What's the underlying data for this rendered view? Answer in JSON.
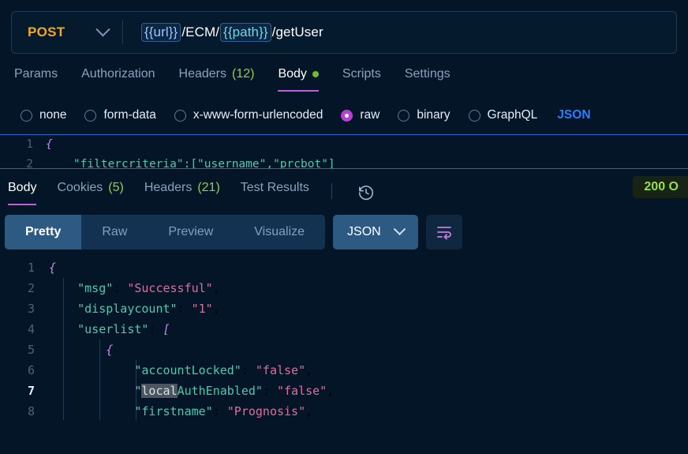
{
  "request": {
    "method": "POST",
    "url_parts": [
      {
        "text": "{{url}}",
        "type": "var-url"
      },
      {
        "text": " /ECM/ ",
        "type": "plain"
      },
      {
        "text": "{{path}}",
        "type": "var-path"
      },
      {
        "text": " /getUser",
        "type": "plain"
      }
    ],
    "url_plain_1": "/ECM/",
    "url_plain_2": "/getUser",
    "var_url": "{{url}}",
    "var_path": "{{path}}",
    "tabs": [
      {
        "label": "Params",
        "active": false
      },
      {
        "label": "Authorization",
        "active": false
      },
      {
        "label": "Headers",
        "count": "(12)",
        "active": false
      },
      {
        "label": "Body",
        "active": true,
        "dot": true
      },
      {
        "label": "Scripts",
        "active": false
      },
      {
        "label": "Settings",
        "active": false
      }
    ],
    "body_types": [
      {
        "label": "none",
        "checked": false
      },
      {
        "label": "form-data",
        "checked": false
      },
      {
        "label": "x-www-form-urlencoded",
        "checked": false
      },
      {
        "label": "raw",
        "checked": true
      },
      {
        "label": "binary",
        "checked": false
      },
      {
        "label": "GraphQL",
        "checked": false
      }
    ],
    "raw_format": "JSON",
    "editor_lines": [
      {
        "num": "1",
        "text": "{"
      },
      {
        "num": "2",
        "text": "    \"filtercriteria\":[\"username\",\"prcbot\"]"
      }
    ]
  },
  "response": {
    "tabs": [
      {
        "label": "Body",
        "active": true
      },
      {
        "label": "Cookies",
        "count": "(5)",
        "active": false
      },
      {
        "label": "Headers",
        "count": "(21)",
        "active": false
      },
      {
        "label": "Test Results",
        "active": false
      }
    ],
    "status": "200 O",
    "history_icon": "clock-history-icon",
    "view_modes": [
      {
        "label": "Pretty",
        "active": true
      },
      {
        "label": "Raw",
        "active": false
      },
      {
        "label": "Preview",
        "active": false
      },
      {
        "label": "Visualize",
        "active": false
      }
    ],
    "format": "JSON",
    "wrap_icon": "word-wrap-icon",
    "body_lines": [
      {
        "num": "1",
        "indent": 0,
        "current": false,
        "segs": [
          {
            "t": "{",
            "c": "p"
          }
        ]
      },
      {
        "num": "2",
        "indent": 1,
        "current": false,
        "segs": [
          {
            "t": "\"msg\"",
            "c": "k"
          },
          {
            "t": ": ",
            "c": ""
          },
          {
            "t": "\"Successful\"",
            "c": "s"
          },
          {
            "t": ",",
            "c": ""
          }
        ]
      },
      {
        "num": "3",
        "indent": 1,
        "current": false,
        "segs": [
          {
            "t": "\"displaycount\"",
            "c": "k"
          },
          {
            "t": ": ",
            "c": ""
          },
          {
            "t": "\"1\"",
            "c": "s"
          },
          {
            "t": ",",
            "c": ""
          }
        ]
      },
      {
        "num": "4",
        "indent": 1,
        "current": false,
        "segs": [
          {
            "t": "\"userlist\"",
            "c": "k"
          },
          {
            "t": ": ",
            "c": ""
          },
          {
            "t": "[",
            "c": "p"
          }
        ]
      },
      {
        "num": "5",
        "indent": 2,
        "current": false,
        "segs": [
          {
            "t": "{",
            "c": "p"
          }
        ]
      },
      {
        "num": "6",
        "indent": 3,
        "current": false,
        "segs": [
          {
            "t": "\"accountLocked\"",
            "c": "k"
          },
          {
            "t": ": ",
            "c": ""
          },
          {
            "t": "\"false\"",
            "c": "s"
          },
          {
            "t": ",",
            "c": ""
          }
        ]
      },
      {
        "num": "7",
        "indent": 3,
        "current": true,
        "segs": [
          {
            "t": "\"",
            "c": "k"
          },
          {
            "t": "local",
            "c": "k sel"
          },
          {
            "t": "AuthEnabled\"",
            "c": "k"
          },
          {
            "t": ": ",
            "c": ""
          },
          {
            "t": "\"false\"",
            "c": "s"
          },
          {
            "t": ",",
            "c": ""
          }
        ]
      },
      {
        "num": "8",
        "indent": 3,
        "current": false,
        "segs": [
          {
            "t": "\"firstname\"",
            "c": "k"
          },
          {
            "t": ": ",
            "c": ""
          },
          {
            "t": "\"Prognosis\"",
            "c": "s"
          },
          {
            "t": ",",
            "c": ""
          }
        ]
      }
    ]
  },
  "colors": {
    "background": "#041527",
    "method": "#f5a623",
    "accent_underline": "#c35ddb",
    "status_text": "#9ade4c",
    "json_key": "#4ec9b0",
    "json_string": "#e06c9f",
    "json_punct": "#c586e8",
    "radio_checked": "#b83fd6"
  }
}
